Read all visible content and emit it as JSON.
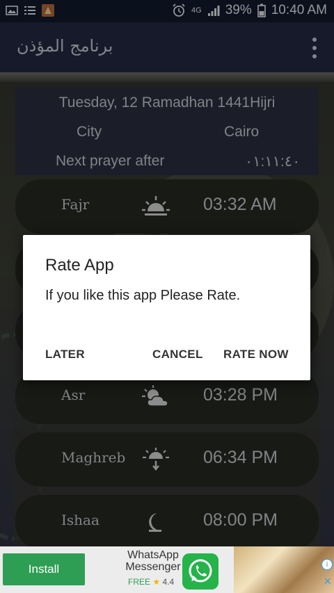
{
  "status_bar": {
    "network": "4G",
    "battery": "39%",
    "time": "10:40 AM"
  },
  "app_bar": {
    "title": "برنامج المؤذن"
  },
  "info": {
    "date": "Tuesday, 12 Ramadhan 1441Hijri",
    "city_label": "City",
    "city": "Cairo",
    "next_label": "Next prayer after",
    "next_value": "٠١:١١:٤٠"
  },
  "prayers": [
    {
      "name": "Fajr",
      "time": "03:32 AM",
      "icon": "sunrise-icon"
    },
    {
      "name": "Asr",
      "time": "03:28 PM",
      "icon": "sun-cloud-icon"
    },
    {
      "name": "Maghreb",
      "time": "06:34 PM",
      "icon": "sunset-icon"
    },
    {
      "name": "Ishaa",
      "time": "08:00 PM",
      "icon": "moon-icon"
    }
  ],
  "dialog": {
    "title": "Rate App",
    "message": "If you like this app Please Rate.",
    "later": "LATER",
    "cancel": "CANCEL",
    "rate_now": "RATE NOW"
  },
  "ad": {
    "install": "Install",
    "app_name": "WhatsApp Messenger",
    "free": "FREE",
    "rating": "4.4",
    "close": "×"
  },
  "colors": {
    "status_bar": "#101a2c",
    "app_bar": "#232942",
    "info_card": "#2a2d3f",
    "prayer_card": "#262822",
    "install_button": "#2e9e54"
  }
}
